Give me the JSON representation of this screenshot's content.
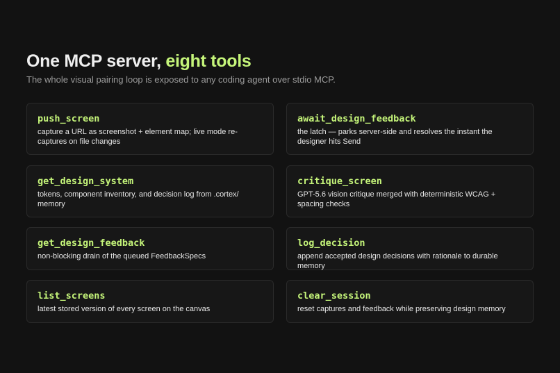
{
  "header": {
    "title_main": "One MCP server, ",
    "title_accent": "eight tools",
    "subtitle": "The whole visual pairing loop is exposed to any coding agent over stdio MCP."
  },
  "colors": {
    "background": "#121212",
    "card_background": "#171717",
    "card_border": "#2a2a2a",
    "accent": "#c5f57a",
    "subtitle": "#9b9b9b"
  },
  "tools": [
    {
      "name": "push_screen",
      "description": "capture a URL as screenshot + element map; live mode re-captures on file changes"
    },
    {
      "name": "await_design_feedback",
      "description": "the latch — parks server-side and resolves the instant the designer hits Send"
    },
    {
      "name": "get_design_system",
      "description": "tokens, component inventory, and decision log from .cortex/ memory"
    },
    {
      "name": "critique_screen",
      "description": "GPT-5.6 vision critique merged with deterministic WCAG + spacing checks"
    },
    {
      "name": "get_design_feedback",
      "description": "non-blocking drain of the queued FeedbackSpecs"
    },
    {
      "name": "log_decision",
      "description": "append accepted design decisions with rationale to durable memory"
    },
    {
      "name": "list_screens",
      "description": "latest stored version of every screen on the canvas"
    },
    {
      "name": "clear_session",
      "description": "reset captures and feedback while preserving design memory"
    }
  ]
}
